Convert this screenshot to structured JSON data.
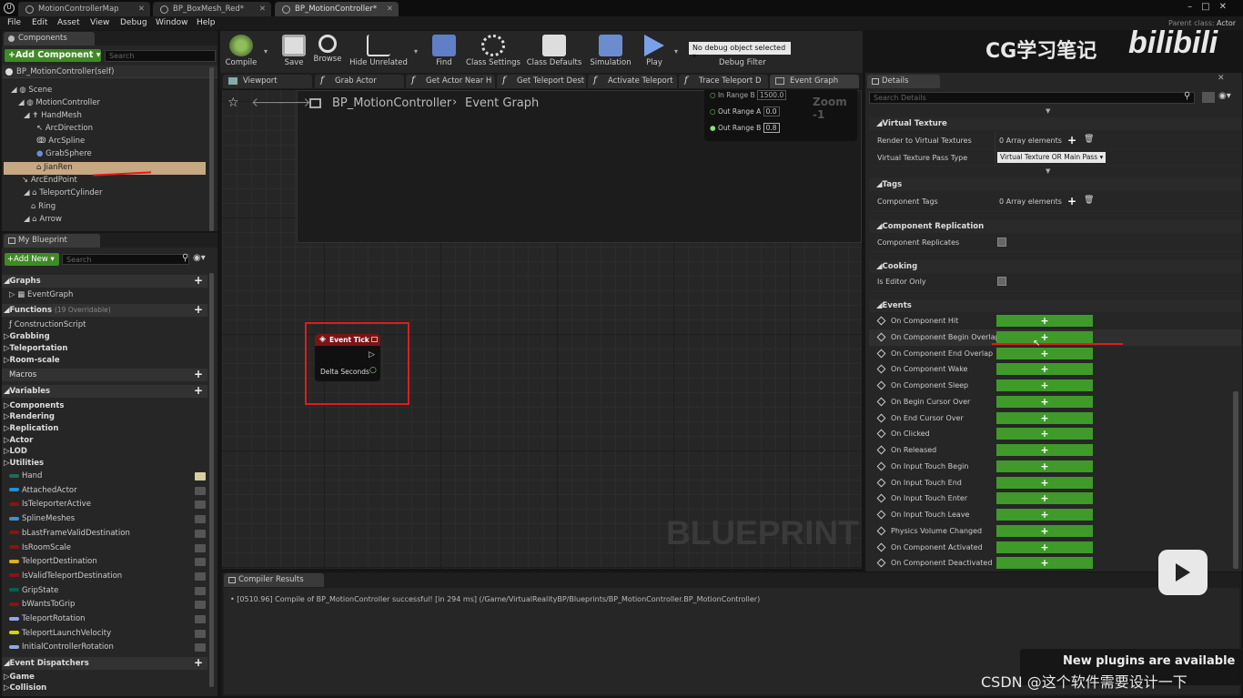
{
  "doc_tabs": [
    {
      "label": "MotionControllerMap"
    },
    {
      "label": "BP_BoxMesh_Red*"
    },
    {
      "label": "BP_MotionController*"
    }
  ],
  "menu": [
    "File",
    "Edit",
    "Asset",
    "View",
    "Debug",
    "Window",
    "Help"
  ],
  "parent_class": {
    "label": "Parent class:",
    "value": "Actor"
  },
  "components": {
    "tab": "Components",
    "add_button": "+Add Component ▾",
    "search_placeholder": "Search",
    "self": "BP_MotionController(self)",
    "tree": [
      "Scene",
      "MotionController",
      "HandMesh",
      "ArcDirection",
      "ArcSpline",
      "GrabSphere",
      "JianRen",
      "ArcEndPoint",
      "TeleportCylinder",
      "Ring",
      "Arrow"
    ]
  },
  "my_blueprint": {
    "tab": "My Blueprint",
    "add_new": "+Add New ▾",
    "search_placeholder": "Search",
    "graphs_label": "Graphs",
    "event_graph": "EventGraph",
    "functions_label": "Functions",
    "functions_count": "(19 Overridable)",
    "construction": "ConstructionScript",
    "func_cats": [
      "Grabbing",
      "Teleportation",
      "Room-scale"
    ],
    "macros_label": "Macros",
    "variables_label": "Variables",
    "var_cats": [
      "Components",
      "Rendering",
      "Replication",
      "Actor",
      "LOD",
      "Utilities"
    ],
    "variables": [
      {
        "name": "Hand",
        "color": "#1f6b5c"
      },
      {
        "name": "AttachedActor",
        "color": "#1f8fd6"
      },
      {
        "name": "IsTeleporterActive",
        "color": "#8a1313"
      },
      {
        "name": "SplineMeshes",
        "color": "#3a8fd6"
      },
      {
        "name": "bLastFrameValidDestination",
        "color": "#8a1313"
      },
      {
        "name": "IsRoomScale",
        "color": "#8a1313"
      },
      {
        "name": "TeleportDestination",
        "color": "#e0b01c"
      },
      {
        "name": "IsValidTeleportDestination",
        "color": "#8a1313"
      },
      {
        "name": "GripState",
        "color": "#0b5e4e"
      },
      {
        "name": "bWantsToGrip",
        "color": "#8a1313"
      },
      {
        "name": "TeleportRotation",
        "color": "#8fa8e8"
      },
      {
        "name": "TeleportLaunchVelocity",
        "color": "#d4d40a"
      },
      {
        "name": "InitialControllerRotation",
        "color": "#8fa8e8"
      }
    ],
    "dispatchers_label": "Event Dispatchers",
    "bottom_cats": [
      "Game",
      "Collision"
    ]
  },
  "toolbar": [
    {
      "label": "Compile"
    },
    {
      "label": "Save"
    },
    {
      "label": "Browse"
    },
    {
      "label": "Hide Unrelated"
    },
    {
      "label": "Find"
    },
    {
      "label": "Class Settings"
    },
    {
      "label": "Class Defaults"
    },
    {
      "label": "Simulation"
    },
    {
      "label": "Play"
    }
  ],
  "debug": {
    "select": "No debug object selected ▾",
    "label": "Debug Filter"
  },
  "editor_tabs": [
    "Viewport",
    "Grab Actor",
    "Get Actor Near H",
    "Get Teleport Dest",
    "Activate Teleport",
    "Trace Teleport D",
    "Event Graph"
  ],
  "graph": {
    "breadcrumb_root": "BP_MotionController",
    "breadcrumb_leaf": "Event Graph",
    "zoom": "Zoom -1",
    "watermark": "BLUEPRINT",
    "map_pins": [
      {
        "label": "In Range B",
        "value": "1500.0"
      },
      {
        "label": "Out Range A",
        "value": "0.0"
      },
      {
        "label": "Out Range B",
        "value": "0.8"
      }
    ],
    "node": {
      "title": "Event Tick",
      "pin": "Delta Seconds"
    }
  },
  "details": {
    "tab": "Details",
    "search_placeholder": "Search Details",
    "virtual_texture": {
      "cat": "Virtual Texture",
      "render_label": "Render to Virtual Textures",
      "render_value": "0 Array elements",
      "pass_label": "Virtual Texture Pass Type",
      "pass_value": "Virtual Texture OR Main Pass ▾"
    },
    "tags": {
      "cat": "Tags",
      "label": "Component Tags",
      "value": "0 Array elements"
    },
    "replication": {
      "cat": "Component Replication",
      "label": "Component Replicates"
    },
    "cooking": {
      "cat": "Cooking",
      "label": "Is Editor Only"
    },
    "events_cat": "Events",
    "events": [
      "On Component Hit",
      "On Component Begin Overlap",
      "On Component End Overlap",
      "On Component Wake",
      "On Component Sleep",
      "On Begin Cursor Over",
      "On End Cursor Over",
      "On Clicked",
      "On Released",
      "On Input Touch Begin",
      "On Input Touch End",
      "On Input Touch Enter",
      "On Input Touch Leave",
      "Physics Volume Changed",
      "On Component Activated",
      "On Component Deactivated"
    ]
  },
  "compiler": {
    "tab": "Compiler Results",
    "message": "[0510.96] Compile of BP_MotionController successful! [in 294 ms] (/Game/VirtualRealityBP/Blueprints/BP_MotionController.BP_MotionController)"
  },
  "overlay": {
    "brand": "CG学习笔记",
    "bilibili": "bilibili",
    "plugins": "New plugins are available",
    "csdn": "CSDN @这个软件需要设计一下"
  }
}
